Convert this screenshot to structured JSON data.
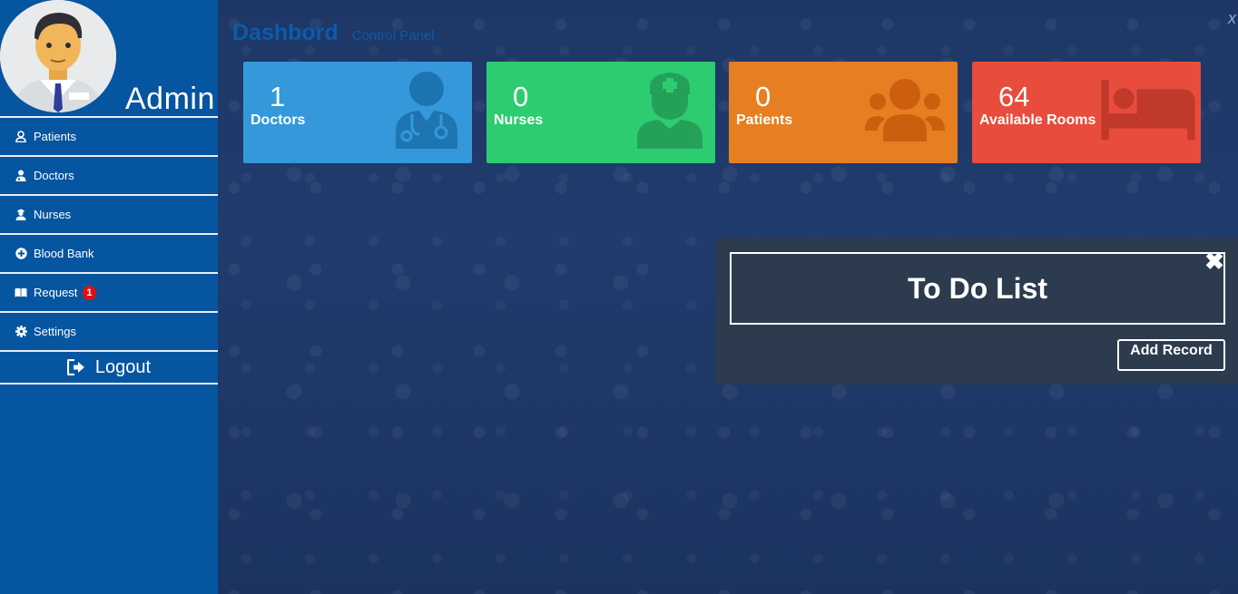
{
  "sidebar": {
    "admin_name": "Admin",
    "items": [
      {
        "label": "Patients",
        "icon": "user-icon"
      },
      {
        "label": "Doctors",
        "icon": "doctor-icon"
      },
      {
        "label": "Nurses",
        "icon": "nurse-icon"
      },
      {
        "label": "Blood Bank",
        "icon": "plus-circle-icon"
      },
      {
        "label": "Request",
        "icon": "book-icon",
        "badge": "1"
      },
      {
        "label": "Settings",
        "icon": "gear-icon"
      }
    ],
    "logout_label": "Logout"
  },
  "header": {
    "title": "Dashbord",
    "subtitle": "Control Panel"
  },
  "cards": [
    {
      "value": "1",
      "label": "Doctors",
      "color": "#3498db",
      "icon": "doctor-icon"
    },
    {
      "value": "0",
      "label": "Nurses",
      "color": "#2ecc71",
      "icon": "nurse-icon"
    },
    {
      "value": "0",
      "label": "Patients",
      "color": "#e67e22",
      "icon": "users-icon"
    },
    {
      "value": "64",
      "label": "Available Rooms",
      "color": "#e74c3c",
      "icon": "bed-icon"
    }
  ],
  "todo": {
    "title": "To Do List",
    "close_symbol": "✖",
    "add_button": "Add Record"
  },
  "colors": {
    "sidebar": "#0555a0",
    "header_text": "#0a5cac",
    "todo_panel": "#2c3b4e"
  }
}
